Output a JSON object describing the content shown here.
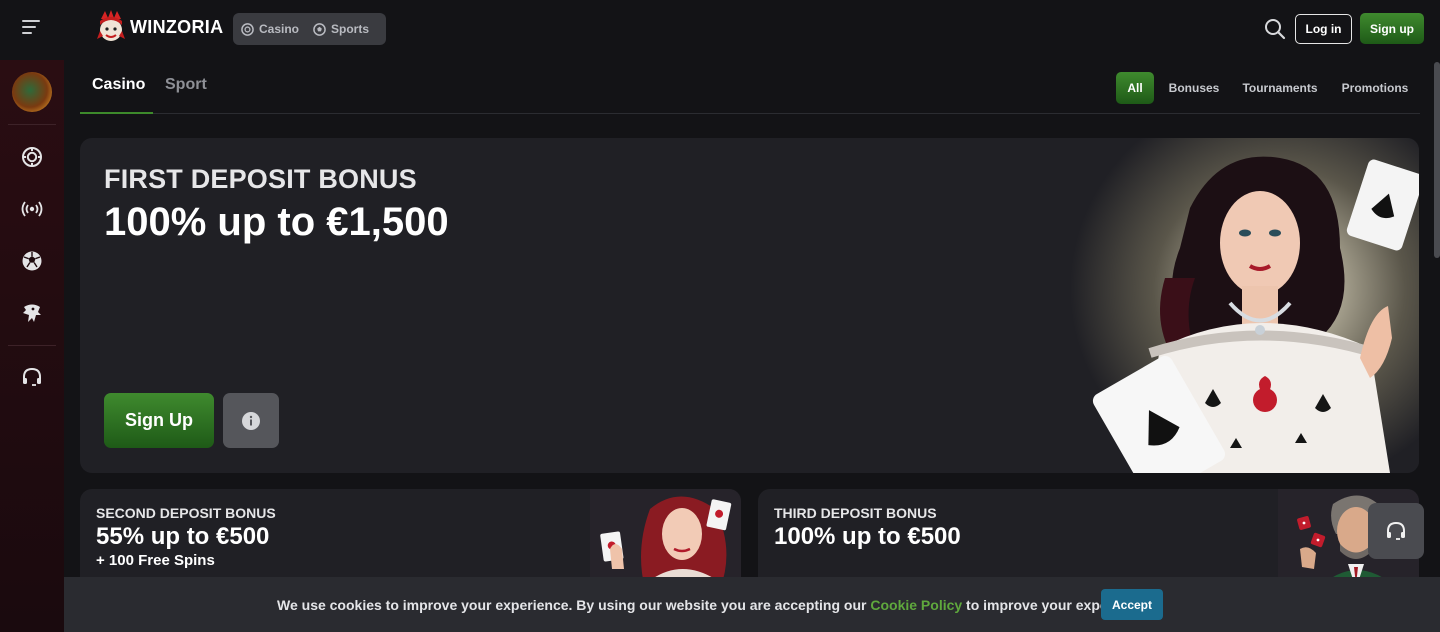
{
  "header": {
    "brand": "WINZORIA",
    "segments": [
      {
        "label": "Casino",
        "icon": "casino-chip-icon"
      },
      {
        "label": "Sports",
        "icon": "soccer-ball-icon"
      }
    ],
    "login_label": "Log in",
    "signup_label": "Sign up"
  },
  "sidebar": {
    "icons": [
      "casino-chip-icon",
      "live-broadcast-icon",
      "soccer-ball-icon",
      "esports-icon",
      "support-headset-icon"
    ]
  },
  "tabs": {
    "items": [
      "Casino",
      "Sport"
    ],
    "active": "Casino"
  },
  "filters": {
    "items": [
      "All",
      "Bonuses",
      "Tournaments",
      "Promotions"
    ],
    "active": "All"
  },
  "hero": {
    "title": "FIRST DEPOSIT BONUS",
    "amount": "100% up to €1,500",
    "signup_label": "Sign Up",
    "info_icon": "info-icon"
  },
  "cards": [
    {
      "title": "SECOND DEPOSIT BONUS",
      "amount": "55% up to €500",
      "extra": "+ 100 Free Spins"
    },
    {
      "title": "THIRD DEPOSIT BONUS",
      "amount": "100% up to €500",
      "extra": ""
    }
  ],
  "cookie": {
    "text_before": "We use cookies to improve your experience. By using our website you are accepting our ",
    "link": "Cookie Policy",
    "text_after": " to improve your experience",
    "accept_label": "Accept"
  },
  "colors": {
    "accent_green": "#3f8a2e",
    "accept_blue": "#1b6b8e",
    "background": "#131316",
    "card": "#202025"
  }
}
